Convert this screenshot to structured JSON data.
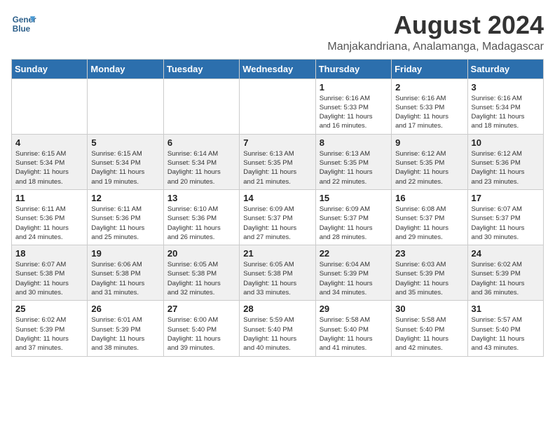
{
  "logo": {
    "line1": "General",
    "line2": "Blue"
  },
  "title": "August 2024",
  "location": "Manjakandriana, Analamanga, Madagascar",
  "weekdays": [
    "Sunday",
    "Monday",
    "Tuesday",
    "Wednesday",
    "Thursday",
    "Friday",
    "Saturday"
  ],
  "weeks": [
    [
      {
        "day": "",
        "info": ""
      },
      {
        "day": "",
        "info": ""
      },
      {
        "day": "",
        "info": ""
      },
      {
        "day": "",
        "info": ""
      },
      {
        "day": "1",
        "info": "Sunrise: 6:16 AM\nSunset: 5:33 PM\nDaylight: 11 hours\nand 16 minutes."
      },
      {
        "day": "2",
        "info": "Sunrise: 6:16 AM\nSunset: 5:33 PM\nDaylight: 11 hours\nand 17 minutes."
      },
      {
        "day": "3",
        "info": "Sunrise: 6:16 AM\nSunset: 5:34 PM\nDaylight: 11 hours\nand 18 minutes."
      }
    ],
    [
      {
        "day": "4",
        "info": "Sunrise: 6:15 AM\nSunset: 5:34 PM\nDaylight: 11 hours\nand 18 minutes."
      },
      {
        "day": "5",
        "info": "Sunrise: 6:15 AM\nSunset: 5:34 PM\nDaylight: 11 hours\nand 19 minutes."
      },
      {
        "day": "6",
        "info": "Sunrise: 6:14 AM\nSunset: 5:34 PM\nDaylight: 11 hours\nand 20 minutes."
      },
      {
        "day": "7",
        "info": "Sunrise: 6:13 AM\nSunset: 5:35 PM\nDaylight: 11 hours\nand 21 minutes."
      },
      {
        "day": "8",
        "info": "Sunrise: 6:13 AM\nSunset: 5:35 PM\nDaylight: 11 hours\nand 22 minutes."
      },
      {
        "day": "9",
        "info": "Sunrise: 6:12 AM\nSunset: 5:35 PM\nDaylight: 11 hours\nand 22 minutes."
      },
      {
        "day": "10",
        "info": "Sunrise: 6:12 AM\nSunset: 5:36 PM\nDaylight: 11 hours\nand 23 minutes."
      }
    ],
    [
      {
        "day": "11",
        "info": "Sunrise: 6:11 AM\nSunset: 5:36 PM\nDaylight: 11 hours\nand 24 minutes."
      },
      {
        "day": "12",
        "info": "Sunrise: 6:11 AM\nSunset: 5:36 PM\nDaylight: 11 hours\nand 25 minutes."
      },
      {
        "day": "13",
        "info": "Sunrise: 6:10 AM\nSunset: 5:36 PM\nDaylight: 11 hours\nand 26 minutes."
      },
      {
        "day": "14",
        "info": "Sunrise: 6:09 AM\nSunset: 5:37 PM\nDaylight: 11 hours\nand 27 minutes."
      },
      {
        "day": "15",
        "info": "Sunrise: 6:09 AM\nSunset: 5:37 PM\nDaylight: 11 hours\nand 28 minutes."
      },
      {
        "day": "16",
        "info": "Sunrise: 6:08 AM\nSunset: 5:37 PM\nDaylight: 11 hours\nand 29 minutes."
      },
      {
        "day": "17",
        "info": "Sunrise: 6:07 AM\nSunset: 5:37 PM\nDaylight: 11 hours\nand 30 minutes."
      }
    ],
    [
      {
        "day": "18",
        "info": "Sunrise: 6:07 AM\nSunset: 5:38 PM\nDaylight: 11 hours\nand 30 minutes."
      },
      {
        "day": "19",
        "info": "Sunrise: 6:06 AM\nSunset: 5:38 PM\nDaylight: 11 hours\nand 31 minutes."
      },
      {
        "day": "20",
        "info": "Sunrise: 6:05 AM\nSunset: 5:38 PM\nDaylight: 11 hours\nand 32 minutes."
      },
      {
        "day": "21",
        "info": "Sunrise: 6:05 AM\nSunset: 5:38 PM\nDaylight: 11 hours\nand 33 minutes."
      },
      {
        "day": "22",
        "info": "Sunrise: 6:04 AM\nSunset: 5:39 PM\nDaylight: 11 hours\nand 34 minutes."
      },
      {
        "day": "23",
        "info": "Sunrise: 6:03 AM\nSunset: 5:39 PM\nDaylight: 11 hours\nand 35 minutes."
      },
      {
        "day": "24",
        "info": "Sunrise: 6:02 AM\nSunset: 5:39 PM\nDaylight: 11 hours\nand 36 minutes."
      }
    ],
    [
      {
        "day": "25",
        "info": "Sunrise: 6:02 AM\nSunset: 5:39 PM\nDaylight: 11 hours\nand 37 minutes."
      },
      {
        "day": "26",
        "info": "Sunrise: 6:01 AM\nSunset: 5:39 PM\nDaylight: 11 hours\nand 38 minutes."
      },
      {
        "day": "27",
        "info": "Sunrise: 6:00 AM\nSunset: 5:40 PM\nDaylight: 11 hours\nand 39 minutes."
      },
      {
        "day": "28",
        "info": "Sunrise: 5:59 AM\nSunset: 5:40 PM\nDaylight: 11 hours\nand 40 minutes."
      },
      {
        "day": "29",
        "info": "Sunrise: 5:58 AM\nSunset: 5:40 PM\nDaylight: 11 hours\nand 41 minutes."
      },
      {
        "day": "30",
        "info": "Sunrise: 5:58 AM\nSunset: 5:40 PM\nDaylight: 11 hours\nand 42 minutes."
      },
      {
        "day": "31",
        "info": "Sunrise: 5:57 AM\nSunset: 5:40 PM\nDaylight: 11 hours\nand 43 minutes."
      }
    ]
  ]
}
